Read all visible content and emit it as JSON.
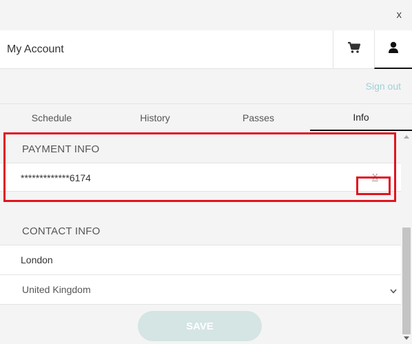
{
  "window": {
    "close_label": "x"
  },
  "header": {
    "title": "My Account",
    "cart_icon": "cart-icon",
    "user_icon": "user-icon"
  },
  "account": {
    "signout_label": "Sign out"
  },
  "tabs": [
    {
      "label": "Schedule",
      "active": false
    },
    {
      "label": "History",
      "active": false
    },
    {
      "label": "Passes",
      "active": false
    },
    {
      "label": "Info",
      "active": true
    }
  ],
  "payment": {
    "title": "PAYMENT INFO",
    "card_masked": "*************6174",
    "remove_label": "X"
  },
  "contact": {
    "title": "CONTACT INFO",
    "city": "London",
    "country": "United Kingdom"
  },
  "actions": {
    "save_label": "SAVE"
  },
  "colors": {
    "highlight": "#e0141f",
    "save_button_bg": "#d4e5e3",
    "signout_link": "#9fd0d8"
  }
}
